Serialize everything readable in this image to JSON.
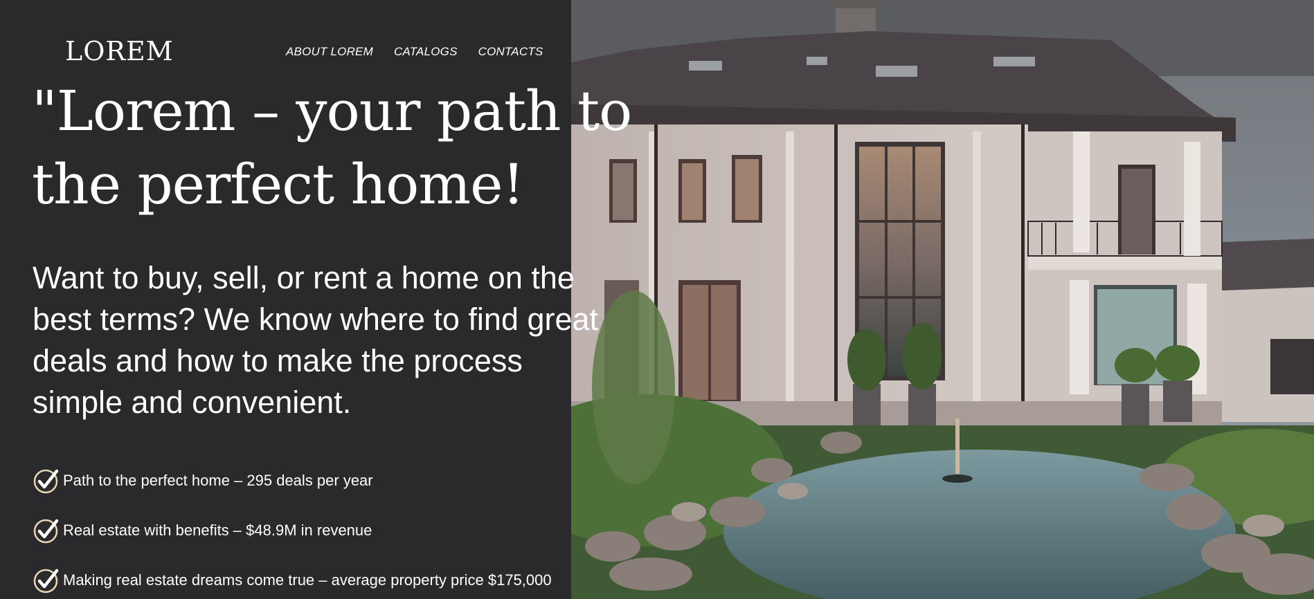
{
  "header": {
    "logo": "LOREM",
    "nav": [
      {
        "label": "ABOUT LOREM"
      },
      {
        "label": "CATALOGS"
      },
      {
        "label": "CONTACTS"
      }
    ]
  },
  "hero": {
    "headline_line1": "\"Lorem – your path to",
    "headline_line2": "the perfect home!",
    "intro": "Want to buy, sell, or rent a home on the best terms? We know where to find great deals and how to make the process simple and convenient.",
    "benefits": [
      {
        "text": "Path to the perfect home – 295 deals per year",
        "icon": "check-circle-icon"
      },
      {
        "text": "Real estate with benefits – $48.9M in revenue",
        "icon": "check-circle-icon"
      },
      {
        "text": "Making real estate dreams come true – average property price $175,000",
        "icon": "check-circle-icon"
      }
    ]
  },
  "colors": {
    "panel_background": "#2a2a2c",
    "text": "#ffffff",
    "check_accent": "#e8d7b5"
  }
}
